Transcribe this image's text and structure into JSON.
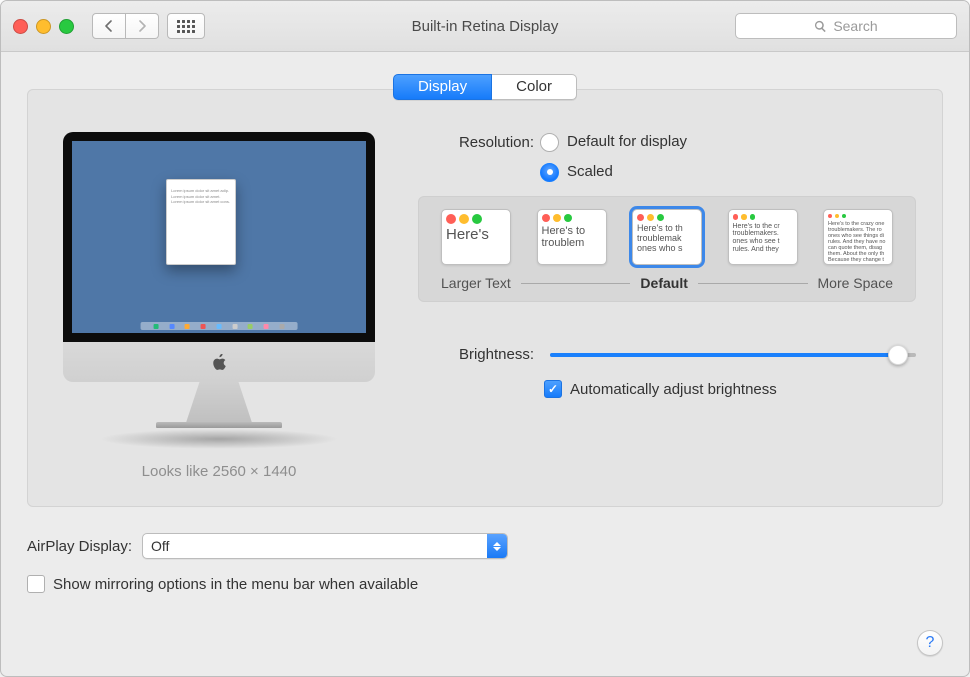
{
  "window": {
    "title": "Built-in Retina Display"
  },
  "toolbar": {
    "search_placeholder": "Search"
  },
  "tabs": {
    "display": "Display",
    "color": "Color",
    "active": "display"
  },
  "preview": {
    "looks_like": "Looks like 2560 × 1440"
  },
  "resolution": {
    "label": "Resolution:",
    "default_label": "Default for display",
    "scaled_label": "Scaled",
    "selected": "scaled",
    "scale_labels": {
      "larger": "Larger Text",
      "default": "Default",
      "more_space": "More Space"
    },
    "sample_text": {
      "s1": "Here's",
      "s2": "Here's to\ntroublem",
      "s3": "Here's to th\ntroublemak\nones who s",
      "s4": "Here's to the cr\ntroublemakers.\nones who see t\nrules. And they",
      "s5": "Here's to the crazy one\ntroublemakers. The ro\nones who see things di\nrules. And they have no\ncan quote them, disag\nthem. About the only th\nBecause they change t"
    }
  },
  "brightness": {
    "label": "Brightness:",
    "value_percent": 95,
    "auto_label": "Automatically adjust brightness",
    "auto_checked": true
  },
  "airplay": {
    "label": "AirPlay Display:",
    "selected": "Off"
  },
  "mirroring": {
    "label": "Show mirroring options in the menu bar when available",
    "checked": false
  },
  "help": {
    "symbol": "?"
  }
}
